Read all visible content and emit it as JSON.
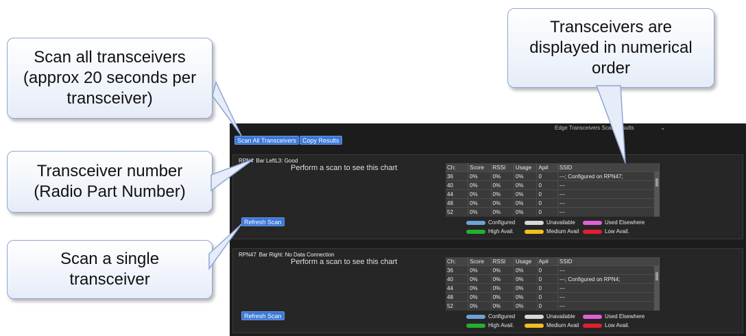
{
  "callouts": {
    "scan_all": "Scan all transceivers\n(approx 20 seconds per\ntransceiver)",
    "numerical": "Transceivers are\ndisplayed in numerical\norder",
    "transceiver_number": "Transceiver number\n(Radio Part Number)",
    "scan_single": "Scan a single\ntransceiver"
  },
  "app": {
    "title": "Edge Transceivers Scan Results",
    "toolbar": {
      "scan_all_label": "Scan All Transceivers",
      "copy_label": "Copy Results"
    },
    "refresh_label": "Refresh Scan",
    "placeholder": "Perform a scan to see this chart",
    "table_headers": [
      "Ch:",
      "Score",
      "RSSI",
      "Usage",
      "Ap#",
      "SSID"
    ],
    "legend": [
      {
        "label": "Configured",
        "color": "#6fa0d8"
      },
      {
        "label": "Unavailable",
        "color": "#d8d8d8"
      },
      {
        "label": "Used Elsewhere",
        "color": "#e060d8"
      },
      {
        "label": "High Avail.",
        "color": "#22b030"
      },
      {
        "label": "Medium Avail",
        "color": "#f0c020"
      },
      {
        "label": "Low Avail.",
        "color": "#e02030"
      }
    ],
    "panels": [
      {
        "rpn": "RPN4",
        "status": "Bar LeftL3: Good",
        "rows": [
          [
            "36",
            "0%",
            "0%",
            "0%",
            "0",
            "---; Configured on RPN47;"
          ],
          [
            "40",
            "0%",
            "0%",
            "0%",
            "0",
            "---"
          ],
          [
            "44",
            "0%",
            "0%",
            "0%",
            "0",
            "---"
          ],
          [
            "48",
            "0%",
            "0%",
            "0%",
            "0",
            "---"
          ],
          [
            "52",
            "0%",
            "0%",
            "0%",
            "0",
            "---"
          ]
        ]
      },
      {
        "rpn": "RPN47",
        "status": "Bar Right: No Data Connection",
        "rows": [
          [
            "36",
            "0%",
            "0%",
            "0%",
            "0",
            "---"
          ],
          [
            "40",
            "0%",
            "0%",
            "0%",
            "0",
            "---; Configured on RPN4;"
          ],
          [
            "44",
            "0%",
            "0%",
            "0%",
            "0",
            "---"
          ],
          [
            "48",
            "0%",
            "0%",
            "0%",
            "0",
            "---"
          ],
          [
            "52",
            "0%",
            "0%",
            "0%",
            "0",
            "---"
          ]
        ]
      }
    ]
  }
}
